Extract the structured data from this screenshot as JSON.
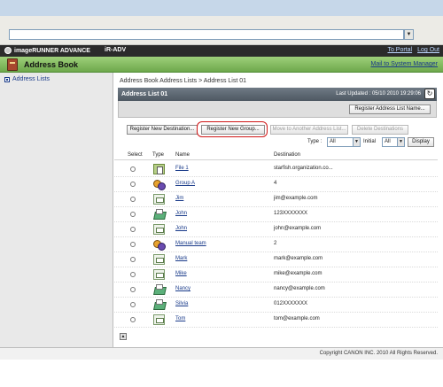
{
  "browser": {
    "address_value": "",
    "dropdown_glyph": "▼"
  },
  "header": {
    "brand": "imageRUNNER ADVANCE",
    "model": "iR-ADV",
    "to_portal": "To Portal",
    "logout": "Log Out"
  },
  "titlebar": {
    "title": "Address Book",
    "mail_link": "Mail to System Manager"
  },
  "sidebar": {
    "items": [
      {
        "label": "Address Lists"
      }
    ]
  },
  "breadcrumb": {
    "part1": "Address Book",
    "sep1": " Address Lists",
    "sep2": " > ",
    "current": "Address List 01"
  },
  "list": {
    "name": "Address List 01",
    "updated": "Last Updated : 05/10 2010 19:29:06",
    "refresh_glyph": "↻",
    "register_list_name": "Register Address List Name..."
  },
  "actions": {
    "register_destination": "Register New Destination...",
    "register_group": "Register New Group...",
    "move": "Move to Another Address List...",
    "delete": "Delete Destinations"
  },
  "filter": {
    "type_label": "Type :",
    "type_value": "All",
    "initial_label": "Initial",
    "initial_value": "All",
    "arrow_glyph": "▼",
    "display": "Display"
  },
  "table": {
    "headers": {
      "select": "Select",
      "type": "Type",
      "name": "Name",
      "destination": "Destination"
    },
    "rows": [
      {
        "type": "file-icon",
        "name": "File 1",
        "destination": "starfish.organization.co..."
      },
      {
        "type": "group-icon",
        "name": "Group A",
        "destination": "4"
      },
      {
        "type": "email-icon",
        "name": "Jim",
        "destination": "jim@example.com"
      },
      {
        "type": "fax-icon",
        "name": "John",
        "destination": "123XXXXXXX"
      },
      {
        "type": "email-icon",
        "name": "John",
        "destination": "john@example.com"
      },
      {
        "type": "group-icon",
        "name": "Manual team",
        "destination": "2"
      },
      {
        "type": "email-icon",
        "name": "Mark",
        "destination": "mark@example.com"
      },
      {
        "type": "email-icon",
        "name": "Mike",
        "destination": "mike@example.com"
      },
      {
        "type": "fax-icon",
        "name": "Nancy",
        "destination": "nancy@example.com"
      },
      {
        "type": "fax-icon",
        "name": "Silvia",
        "destination": "012XXXXXXX"
      },
      {
        "type": "email-icon",
        "name": "Tom",
        "destination": "tom@example.com"
      }
    ]
  },
  "scroll_top_glyph": "▲",
  "footer": {
    "copyright": "Copyright CANON INC. 2010 All Rights Reserved."
  },
  "colors": {
    "title_green": "#8cc068",
    "header_dark": "#2b2b2b",
    "link_blue": "#1a3b8a",
    "highlight_red": "#d01616"
  }
}
